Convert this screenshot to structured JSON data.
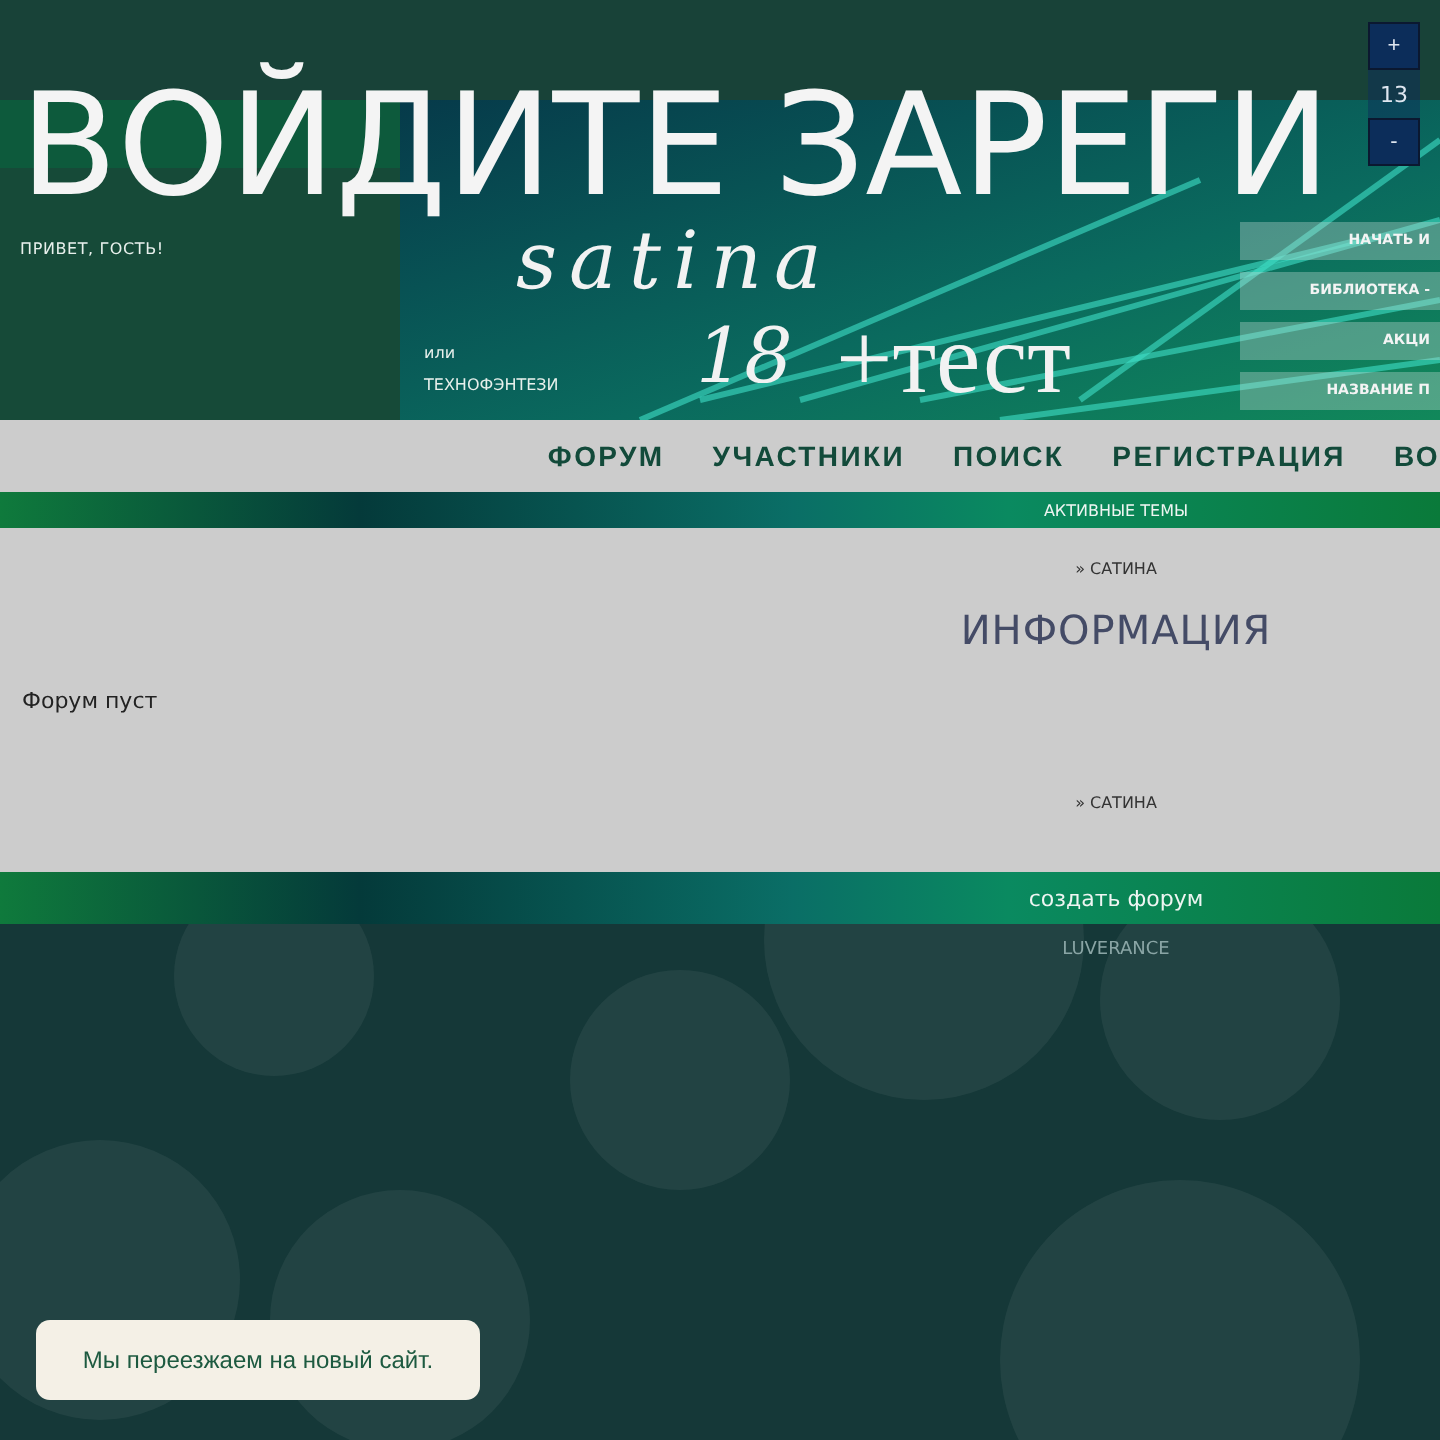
{
  "login_banner": {
    "text": "ВОЙДИТЕ ЗАРЕГИ"
  },
  "font_size_control": {
    "increase": "+",
    "value": "13",
    "decrease": "-"
  },
  "header": {
    "greeting": "ПРИВЕТ, ГОСТЬ!",
    "genre": "ТЕХНОФЭНТЕЗИ",
    "separator": "или",
    "logo": {
      "script": "satina",
      "age": "18",
      "suffix": "+тест"
    }
  },
  "quick_links": [
    "НАЧАТЬ И",
    "БИБЛИОТЕКА -",
    "АКЦИ",
    "НАЗВАНИЕ П"
  ],
  "nav": {
    "items": [
      "ФОРУМ",
      "УЧАСТНИКИ",
      "ПОИСК",
      "РЕГИСТРАЦИЯ",
      "ВО"
    ]
  },
  "active_topics": "АКТИВНЫЕ ТЕМЫ",
  "content": {
    "empty_message": "Форум пуст",
    "top_link": "» САТИНА",
    "title": "ИНФОРМАЦИЯ",
    "bottom_link": "» САТИНА"
  },
  "footer": {
    "create_link": "создать форум",
    "credit": "LUVERANCE"
  },
  "toast": {
    "text": "Мы переезжаем на новый сайт."
  }
}
